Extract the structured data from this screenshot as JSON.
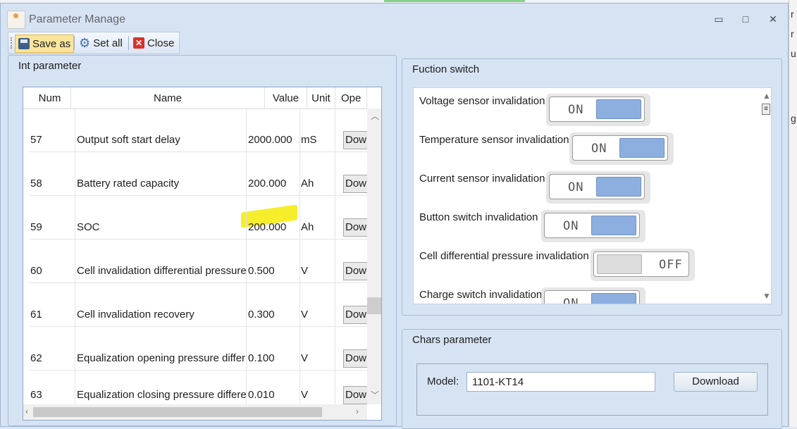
{
  "window": {
    "title": "Parameter Manage",
    "controls": {
      "minimize": "▭",
      "maximize": "□",
      "close": "✕"
    }
  },
  "toolbar": {
    "save_as": "Save as",
    "set_all": "Set all",
    "close": "Close"
  },
  "int_parameter": {
    "title": "Int parameter",
    "columns": [
      "Num",
      "Name",
      "Value",
      "Unit",
      "Ope"
    ],
    "rows": [
      {
        "num": "57",
        "name": "Output soft start delay",
        "value": "2000.000",
        "unit": "mS",
        "action": "Dow"
      },
      {
        "num": "58",
        "name": "Battery rated capacity",
        "value": "200.000",
        "unit": "Ah",
        "action": "Dow"
      },
      {
        "num": "59",
        "name": "SOC",
        "value": "200.000",
        "unit": "Ah",
        "action": "Dow",
        "highlighted": true
      },
      {
        "num": "60",
        "name": "Cell invalidation differential pressure",
        "value": "0.500",
        "unit": "V",
        "action": "Dow"
      },
      {
        "num": "61",
        "name": "Cell invalidation recovery",
        "value": "0.300",
        "unit": "V",
        "action": "Dow"
      },
      {
        "num": "62",
        "name": "Equalization opening pressure differ",
        "value": "0.100",
        "unit": "V",
        "action": "Dow"
      },
      {
        "num": "63",
        "name": "Equalization closing pressure differe",
        "value": "0.010",
        "unit": "V",
        "action": "Dow"
      }
    ]
  },
  "function_switch": {
    "title": "Fuction switch",
    "items": [
      {
        "label": "Voltage sensor invalidation",
        "state": "ON"
      },
      {
        "label": "Temperature sensor invalidation",
        "state": "ON"
      },
      {
        "label": "Current sensor invalidation",
        "state": "ON"
      },
      {
        "label": "Button switch invalidation",
        "state": "ON"
      },
      {
        "label": "Cell differential pressure invalidation",
        "state": "OFF"
      },
      {
        "label": "Charge switch invalidation",
        "state": "ON"
      }
    ]
  },
  "chars_parameter": {
    "title": "Chars parameter",
    "model_label": "Model:",
    "model_value": "1101-KT14",
    "download_label": "Download"
  },
  "colors": {
    "window_bg": "#d6e3f3",
    "toggle_on": "#8dafe0",
    "highlight": "#f6ee2a",
    "close_icon": "#d8322d"
  }
}
